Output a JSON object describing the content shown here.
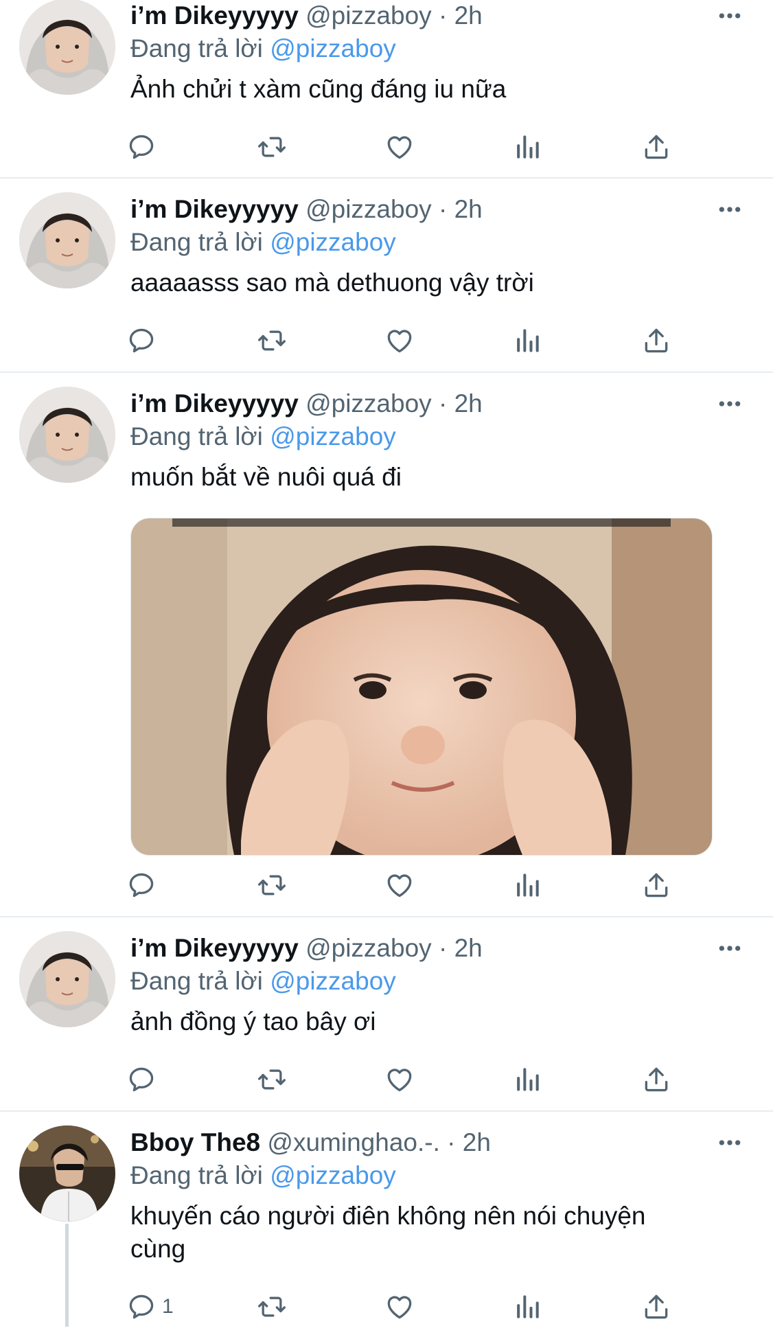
{
  "tweets": [
    {
      "name": "i’m Dikeyyyyy",
      "handle": "@pizzaboy",
      "sep": "·",
      "time": "2h",
      "reply_prefix": "Đang trả lời",
      "reply_to": "@pizzaboy",
      "text": "Ảnh chửi t xàm cũng đáng iu nữa",
      "reply_count": ""
    },
    {
      "name": "i’m Dikeyyyyy",
      "handle": "@pizzaboy",
      "sep": "·",
      "time": "2h",
      "reply_prefix": "Đang trả lời",
      "reply_to": "@pizzaboy",
      "text": "aaaaasss sao mà dethuong vậy trời",
      "reply_count": ""
    },
    {
      "name": "i’m Dikeyyyyy",
      "handle": "@pizzaboy",
      "sep": "·",
      "time": "2h",
      "reply_prefix": "Đang trả lời",
      "reply_to": "@pizzaboy",
      "text": "muốn bắt về nuôi quá đi",
      "reply_count": ""
    },
    {
      "name": "i’m Dikeyyyyy",
      "handle": "@pizzaboy",
      "sep": "·",
      "time": "2h",
      "reply_prefix": "Đang trả lời",
      "reply_to": "@pizzaboy",
      "text": "ảnh đồng ý tao bây ơi",
      "reply_count": ""
    },
    {
      "name": "Bboy The8",
      "handle": "@xuminghao.-.",
      "sep": "·",
      "time": "2h",
      "reply_prefix": "Đang trả lời",
      "reply_to": "@pizzaboy",
      "text": "khuyến cáo người điên không nên nói chuyện cùng",
      "reply_count": "1"
    }
  ],
  "icons": {
    "reply": "reply-icon",
    "retweet": "retweet-icon",
    "like": "heart-icon",
    "views": "views-icon",
    "share": "share-icon",
    "more": "more-icon"
  },
  "colors": {
    "mention": "#4a99e9",
    "secondary_text": "#536471",
    "icon": "#536471",
    "divider": "#e6ecf0"
  }
}
